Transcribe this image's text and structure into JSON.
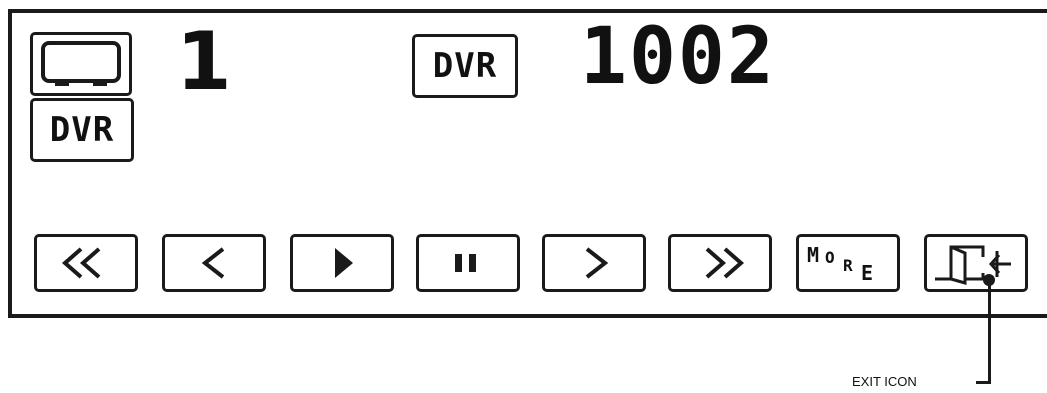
{
  "status": {
    "channel_number": "1",
    "dvr_channel_number": "1002",
    "dvr_badge_label": "DVR",
    "source_dvr_label": "DVR"
  },
  "controls": [
    {
      "name": "rewind",
      "icon": "double-chevron-left-icon"
    },
    {
      "name": "skip-back",
      "icon": "chevron-left-icon"
    },
    {
      "name": "play",
      "icon": "play-icon"
    },
    {
      "name": "pause",
      "icon": "pause-icon"
    },
    {
      "name": "skip-forward",
      "icon": "chevron-right-icon"
    },
    {
      "name": "fast-forward",
      "icon": "double-chevron-right-icon"
    },
    {
      "name": "more",
      "icon": "more-icon",
      "label_parts": [
        "M",
        "O",
        "R",
        "E"
      ]
    },
    {
      "name": "exit",
      "icon": "exit-icon"
    }
  ],
  "callout": {
    "text": "EXIT ICON"
  },
  "colors": {
    "ink": "#1a1a1a",
    "background": "#ffffff"
  }
}
